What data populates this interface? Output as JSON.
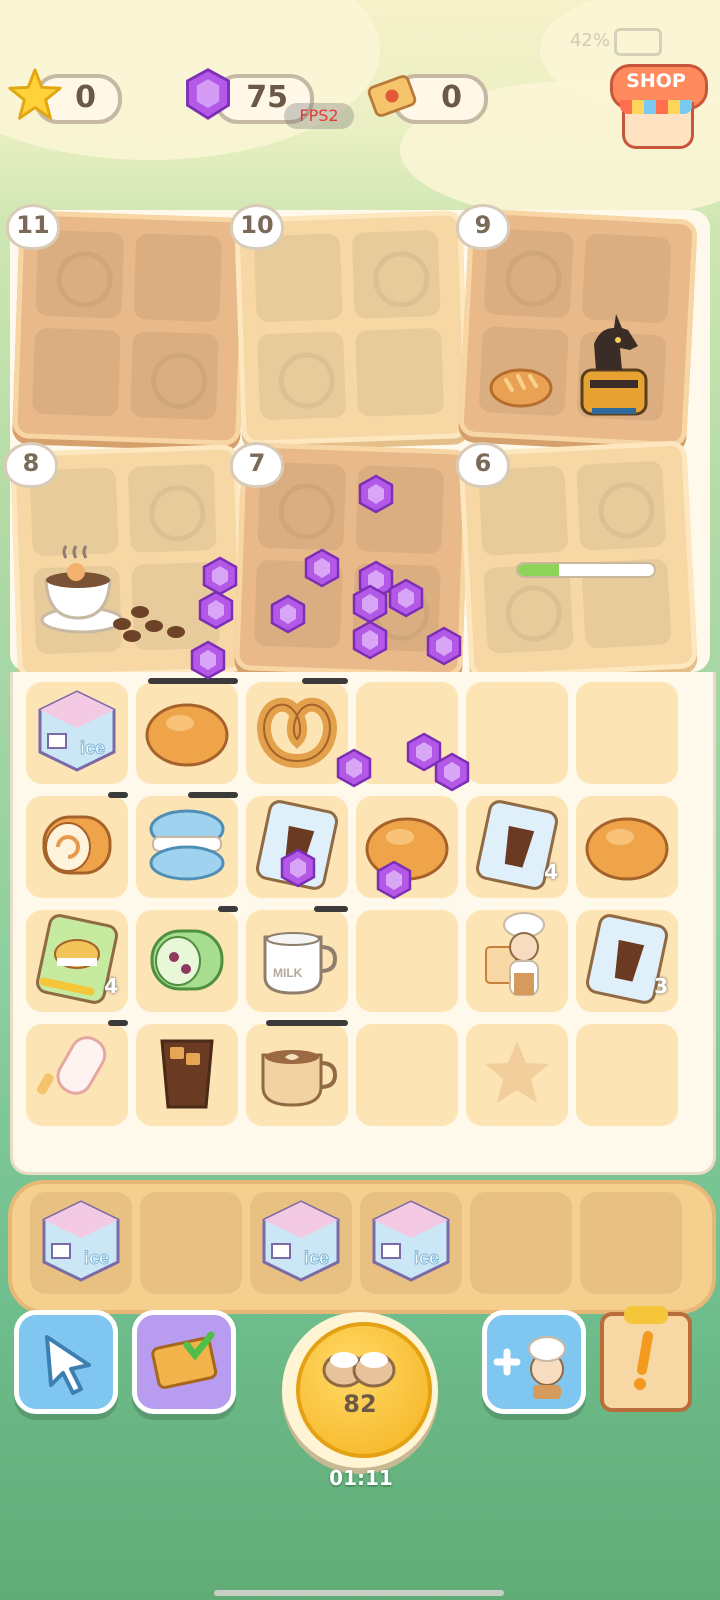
{
  "status": {
    "battery": "42%"
  },
  "currencies": {
    "stars": "0",
    "gems": "75",
    "tickets": "0"
  },
  "fps_label": "FPS2",
  "shop_label": "SHOP",
  "crates": [
    {
      "level": "11"
    },
    {
      "level": "10"
    },
    {
      "level": "9"
    },
    {
      "level": "8"
    },
    {
      "level": "7"
    },
    {
      "level": "6"
    }
  ],
  "crate6_progress": 0.3,
  "grid_items": [
    {
      "name": "ice-machine"
    },
    {
      "name": "bun"
    },
    {
      "name": "pretzel"
    },
    {
      "name": "empty"
    },
    {
      "name": "empty"
    },
    {
      "name": "empty"
    },
    {
      "name": "swiss-roll"
    },
    {
      "name": "macaron"
    },
    {
      "name": "coffee-card",
      "count": ""
    },
    {
      "name": "bun"
    },
    {
      "name": "coffee-card",
      "count": "4"
    },
    {
      "name": "bun"
    },
    {
      "name": "burger-card",
      "count": "4"
    },
    {
      "name": "matcha-roll"
    },
    {
      "name": "milk"
    },
    {
      "name": "empty"
    },
    {
      "name": "chef"
    },
    {
      "name": "coffee-card",
      "count": "3"
    },
    {
      "name": "popsicle"
    },
    {
      "name": "iced-coffee"
    },
    {
      "name": "latte"
    },
    {
      "name": "empty"
    },
    {
      "name": "star-slot"
    },
    {
      "name": "empty"
    }
  ],
  "storage": [
    "ice-machine",
    "empty",
    "ice-machine",
    "ice-machine",
    "empty",
    "empty"
  ],
  "ice_label": "ice",
  "milk_label": "MILK",
  "produce": {
    "count": "82",
    "timer": "01:11"
  },
  "colors": {
    "gem": "#b458e8",
    "accent": "#f5b21e"
  }
}
